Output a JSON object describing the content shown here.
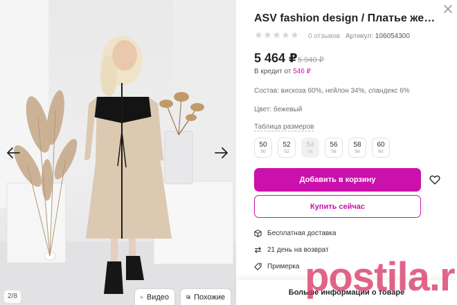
{
  "gallery": {
    "counter": "2/8",
    "video_label": "Видео",
    "similar_label": "Похожие"
  },
  "product": {
    "title": "ASV fashion design / Платье жен…",
    "rating_stars": 0,
    "reviews": "0 отзывов",
    "article_label": "Артикул:",
    "article_value": "106054300",
    "price": "5 464 ₽",
    "old_price": "5 940 ₽",
    "credit_label": "В кредит от",
    "credit_value": "546 ₽",
    "composition": "Состав: вискоза 60%, нейлон 34%, спандекс 6%",
    "color": "Цвет: бежевый",
    "sizes_link": "Таблица размеров",
    "sizes": [
      {
        "size": "50",
        "ru": "50",
        "available": true
      },
      {
        "size": "52",
        "ru": "52",
        "available": true
      },
      {
        "size": "54",
        "ru": "54",
        "available": false
      },
      {
        "size": "56",
        "ru": "56",
        "available": true
      },
      {
        "size": "58",
        "ru": "58",
        "available": true
      },
      {
        "size": "60",
        "ru": "60",
        "available": true
      }
    ]
  },
  "actions": {
    "add_to_cart": "Добавить в корзину",
    "buy_now": "Купить сейчас"
  },
  "features": {
    "delivery": "Бесплатная доставка",
    "return": "21 день на возврат",
    "fitting": "Примерка"
  },
  "more_info": "Больше информации о товаре",
  "watermark": "postila.ru",
  "colors": {
    "accent": "#cb11ab",
    "text": "#242424",
    "muted": "#a0a0a0",
    "watermark": "#d6285a"
  }
}
